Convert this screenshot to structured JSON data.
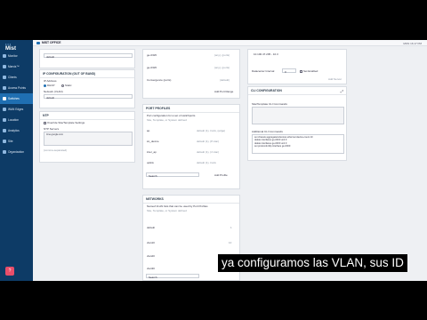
{
  "sidebar": {
    "logo": "Mist",
    "items": [
      {
        "label": "Monitor"
      },
      {
        "label": "Marvis™"
      },
      {
        "label": "Clients"
      },
      {
        "label": "Access Points"
      },
      {
        "label": "Switches"
      },
      {
        "label": "WAN Edges"
      },
      {
        "label": "Location"
      },
      {
        "label": "Analytics"
      },
      {
        "label": "Site"
      },
      {
        "label": "Organization"
      }
    ]
  },
  "topbar": {
    "site_label": "MIST OFFICE",
    "date": "MON 16:17 PM"
  },
  "left_col": {
    "dns_select": "default",
    "ip_config_title": "IP CONFIGURATION (OUT OF BAND)",
    "ip_address_label": "IP Address",
    "dhcp_label": "DHCP",
    "static_label": "Static",
    "network_label": "Network (VLAN)",
    "network_value": "default",
    "ntp_title": "NTP",
    "override_label": "Override Site/Template Settings",
    "ntp_servers_label": "NTP Servers",
    "ntp_value": "time.google.com",
    "ntp_hint": "(comma-separated)"
  },
  "mid_top": {
    "rows": [
      {
        "name": "ge-0/0/0",
        "value": "(any), (ports)"
      },
      {
        "name": "ge-0/0/0",
        "value": "(any), (ports)"
      },
      {
        "name": "Convergence (ports)",
        "value": "(default)"
      }
    ],
    "add_link": "Add Port Range"
  },
  "port_profiles": {
    "title": "PORT PROFILES",
    "desc": "Port configuration for a set of switchports",
    "sub": "Site, Template, or System defined",
    "rows": [
      {
        "name": "ap",
        "value": "default (1), trunk, (edge)"
      },
      {
        "name": "iot_device",
        "value": "default (1), (8 vlan)"
      },
      {
        "name": "inter_ap",
        "value": "default (1), (4 vlan)"
      },
      {
        "name": "uplink",
        "value": "default (1), trunk"
      }
    ],
    "search_placeholder": "Search",
    "add_link": "Add Profile"
  },
  "networks": {
    "title": "NETWORKS",
    "desc": "Named VLAN lists that can be used by Port Profiles",
    "sub": "Site, Template, or System defined",
    "rows": [
      {
        "name": "default",
        "value": "1"
      },
      {
        "name": "vlan10",
        "value": "10"
      },
      {
        "name": "vlan20",
        "value": ""
      },
      {
        "name": "vlan30",
        "value": ""
      }
    ],
    "search_placeholder": "Search",
    "add_link": "Add Network"
  },
  "right_col": {
    "ip_value": "10.100.47.205 - 10.3",
    "interval_label": "Datacenter Interval",
    "interval_value": "0",
    "enable_label": "Set Enabled",
    "add_btn": "Add Server",
    "cli_title": "CLI CONFIGURATION",
    "cli_label1": "Site/Template CLI Commands",
    "cli_label2": "Additional CLI Commands",
    "cli_lines": [
      "set chassis aggregated-devices ethernet device-count 10",
      "delete interfaces ge-0/0/0 unit 0",
      "delete interfaces ge-0/0/0 unit 0",
      "set protocols lldp interface ge-0/0/0"
    ]
  },
  "caption": "ya configuramos las VLAN, sus ID"
}
